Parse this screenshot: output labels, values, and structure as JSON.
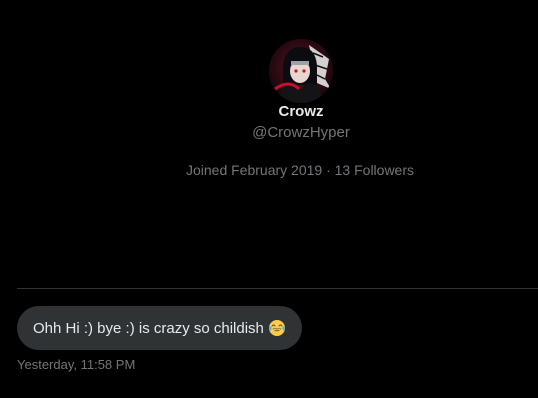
{
  "profile": {
    "display_name": "Crowz",
    "handle": "@CrowzHyper",
    "joined": "Joined February 2019",
    "separator": "·",
    "followers": "13 Followers",
    "avatar_icon": "anime-character-avatar"
  },
  "message": {
    "text": "Ohh Hi :) bye :) is crazy so childish",
    "emoji_icon": "face-with-tears-of-joy-icon",
    "timestamp": "Yesterday, 11:58 PM"
  },
  "colors": {
    "background": "#000000",
    "primary_text": "#e7e9ea",
    "secondary_text": "#71767b",
    "bubble": "#2f3336",
    "divider": "#2f3336"
  }
}
